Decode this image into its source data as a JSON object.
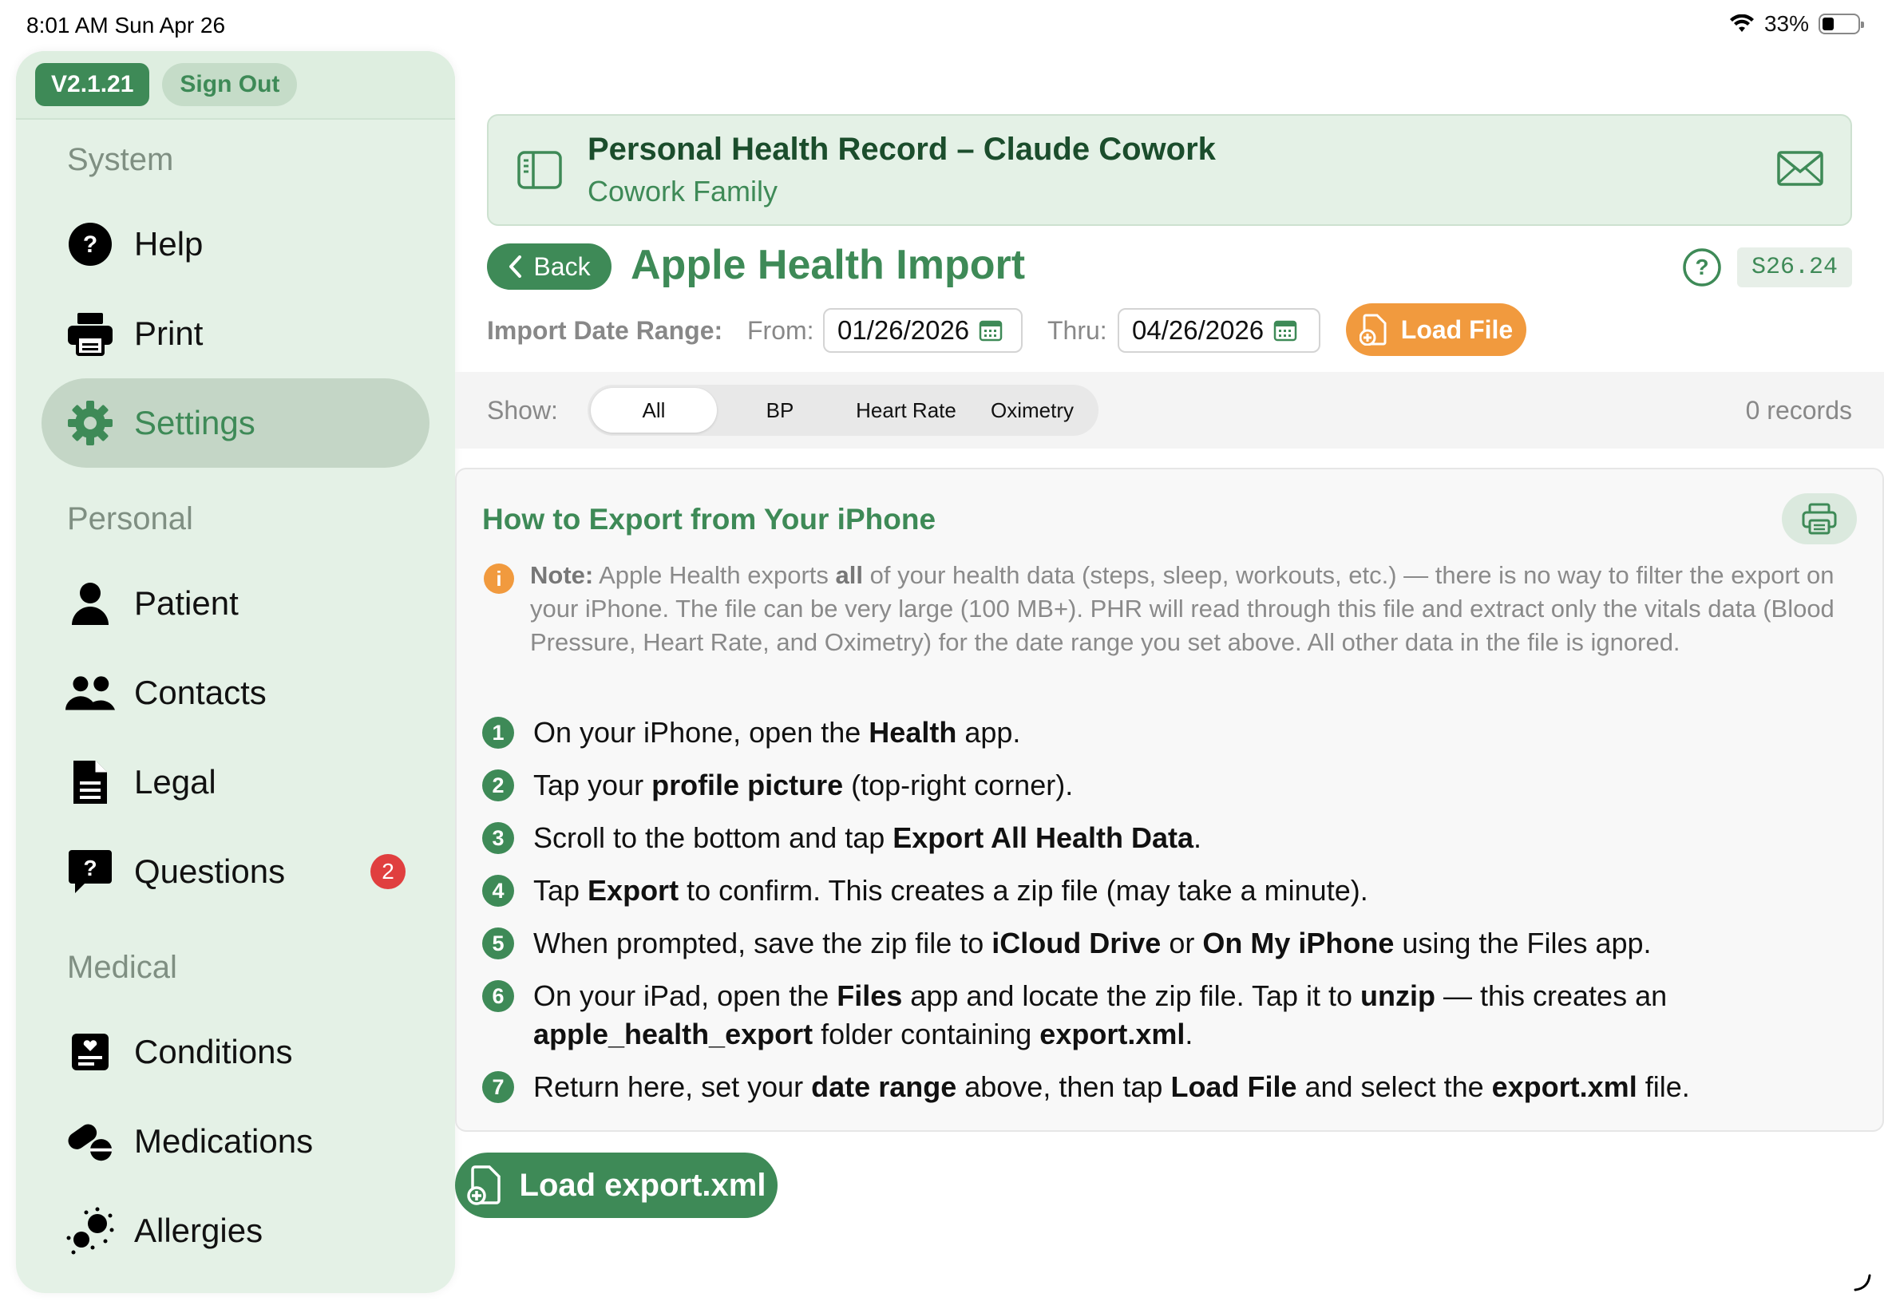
{
  "status_bar": {
    "time": "8:01 AM   Sun Apr 26",
    "battery": "33%"
  },
  "sidebar": {
    "version": "V2.1.21",
    "sign_out": "Sign Out",
    "sections": {
      "system": "System",
      "personal": "Personal",
      "medical": "Medical"
    },
    "items": {
      "help": "Help",
      "print": "Print",
      "settings": "Settings",
      "patient": "Patient",
      "contacts": "Contacts",
      "legal": "Legal",
      "questions": "Questions",
      "questions_badge": "2",
      "conditions": "Conditions",
      "medications": "Medications",
      "allergies": "Allergies"
    }
  },
  "header": {
    "title": "Personal Health Record – Claude Cowork",
    "subtitle": "Cowork Family"
  },
  "page": {
    "back_label": "Back",
    "title": "Apple Health Import",
    "screen_code": "S26.24"
  },
  "date_range": {
    "label": "Import Date Range:",
    "from_label": "From:",
    "from_value": "01/26/2026",
    "thru_label": "Thru:",
    "thru_value": "04/26/2026",
    "load_file": "Load File"
  },
  "filter": {
    "label": "Show:",
    "options": [
      "All",
      "BP",
      "Heart Rate",
      "Oximetry"
    ],
    "selected": "All",
    "records": "0 records"
  },
  "instructions": {
    "title": "How to Export from Your iPhone",
    "note_label": "Note:",
    "note_text_1": "Apple Health exports",
    "note_bold": "all",
    "note_text_2": "of your health data (steps, sleep, workouts, etc.) — there is no way to filter the export on your iPhone. The file can be very large (100 MB+). PHR will read through this file and extract only the vitals data (Blood Pressure, Heart Rate, and Oximetry) for the date range you set above. All other data in the file is ignored.",
    "steps": [
      {
        "num": "1",
        "parts": [
          "On your iPhone, open the ",
          "Health",
          " app."
        ]
      },
      {
        "num": "2",
        "parts": [
          "Tap your ",
          "profile picture",
          " (top-right corner)."
        ]
      },
      {
        "num": "3",
        "parts": [
          "Scroll to the bottom and tap ",
          "Export All Health Data",
          "."
        ]
      },
      {
        "num": "4",
        "parts": [
          "Tap ",
          "Export",
          " to confirm. This creates a zip file (may take a minute)."
        ]
      },
      {
        "num": "5",
        "parts": [
          "When prompted, save the zip file to ",
          "iCloud Drive",
          " or ",
          "On My iPhone",
          " using the Files app."
        ]
      },
      {
        "num": "6",
        "parts": [
          "On your iPad, open the ",
          "Files",
          " app and locate the zip file. Tap it to ",
          "unzip",
          " — this creates an ",
          "apple_health_export",
          " folder containing ",
          "export.xml",
          "."
        ]
      },
      {
        "num": "7",
        "parts": [
          "Return here, set your ",
          "date range",
          " above, then tap ",
          "Load File",
          " and select the ",
          "export.xml",
          " file."
        ]
      }
    ]
  },
  "load_export": "Load export.xml",
  "colors": {
    "brand_green": "#3e8a57",
    "sidebar_bg": "#e4f1e6",
    "accent_orange": "#f19a3e",
    "badge_red": "#e03f3f"
  }
}
